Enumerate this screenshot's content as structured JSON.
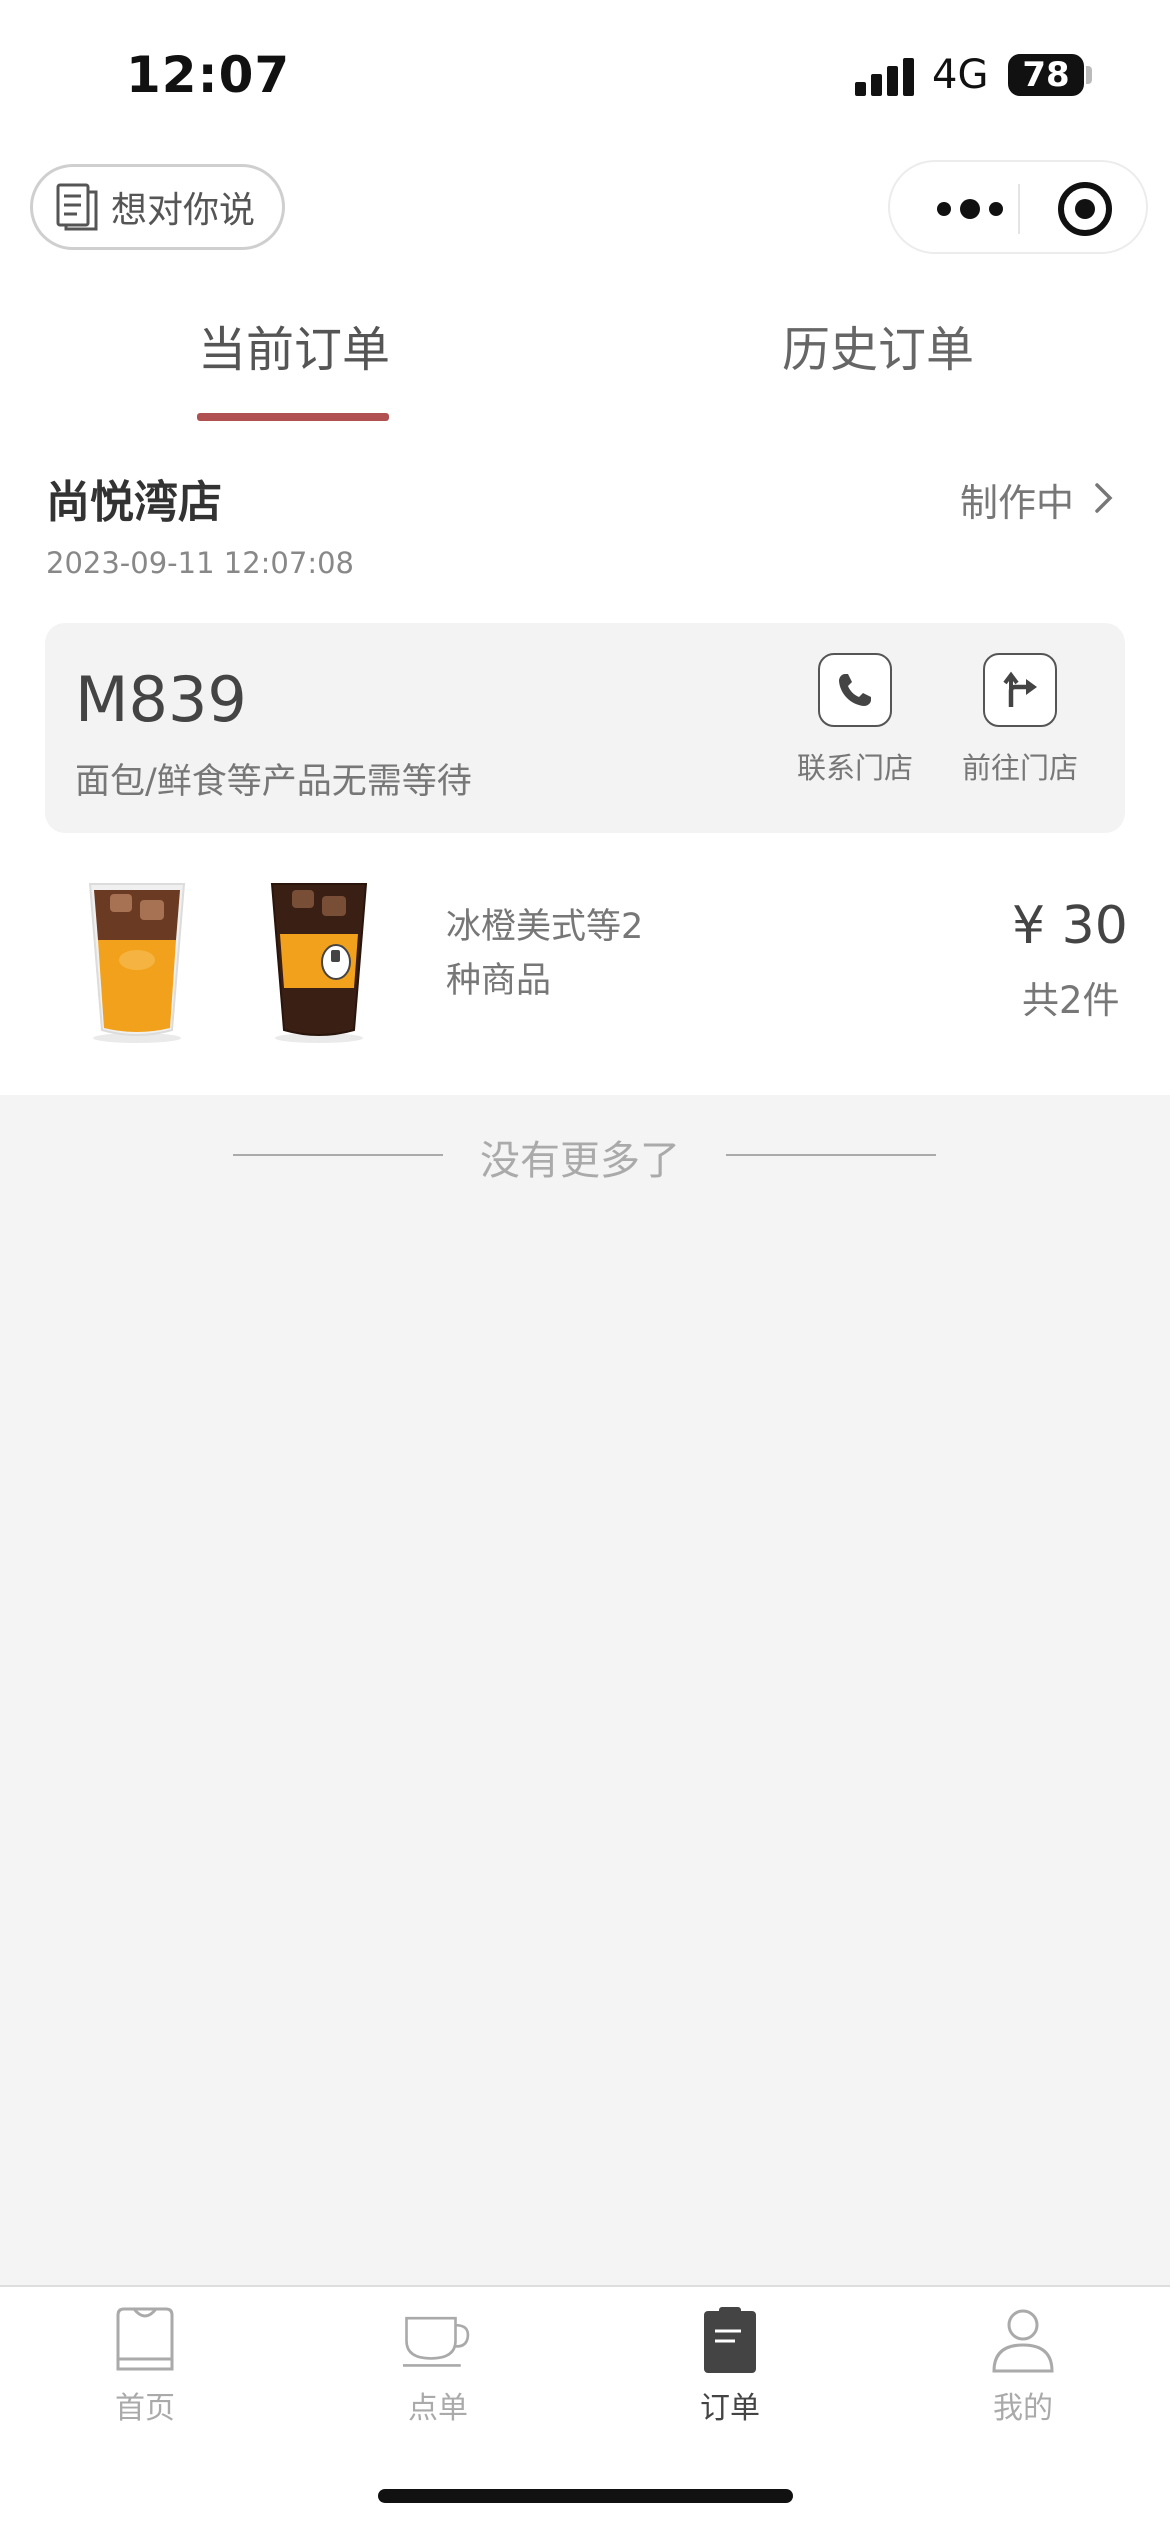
{
  "status_bar": {
    "time": "12:07",
    "network": "4G",
    "battery": "78"
  },
  "nav": {
    "feedback_label": "想对你说"
  },
  "tabs": [
    {
      "label": "当前订单",
      "active": true
    },
    {
      "label": "历史订单",
      "active": false
    }
  ],
  "order": {
    "store": "尚悦湾店",
    "status": "制作中",
    "time": "2023-09-11 12:07:08",
    "pickup_code": "M839",
    "pickup_note": "面包/鲜食等产品无需等待",
    "actions": {
      "call": "联系门店",
      "goto": "前往门店"
    },
    "summary": "冰橙美式等2种商品",
    "price": "¥ 30",
    "count": "共2件"
  },
  "end_text": "没有更多了",
  "tabbar": [
    {
      "label": "首页",
      "icon": "shirt-icon"
    },
    {
      "label": "点单",
      "icon": "cup-icon"
    },
    {
      "label": "订单",
      "icon": "order-doc-icon",
      "active": true
    },
    {
      "label": "我的",
      "icon": "person-icon"
    }
  ],
  "colors": {
    "accent": "#b05050",
    "background": "#f4f4f4"
  }
}
